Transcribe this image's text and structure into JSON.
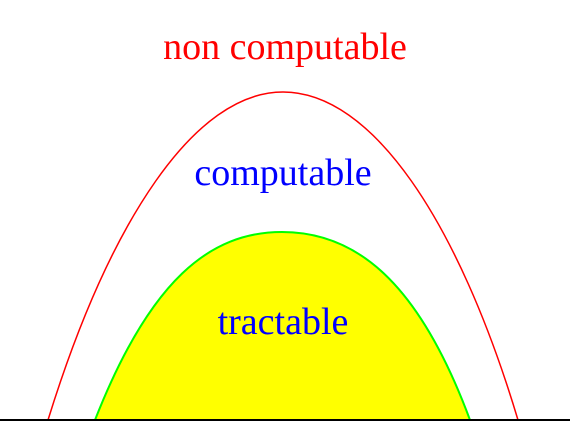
{
  "labels": {
    "outer": "non computable",
    "middle": "computable",
    "inner": "tractable"
  },
  "colors": {
    "outer_text": "#ff0000",
    "outer_curve": "#ff0000",
    "middle_text": "#0000ff",
    "inner_text": "#0000ff",
    "inner_fill": "#ffff00",
    "inner_stroke": "#00ff00",
    "baseline": "#000000",
    "background": "#ffffff"
  }
}
